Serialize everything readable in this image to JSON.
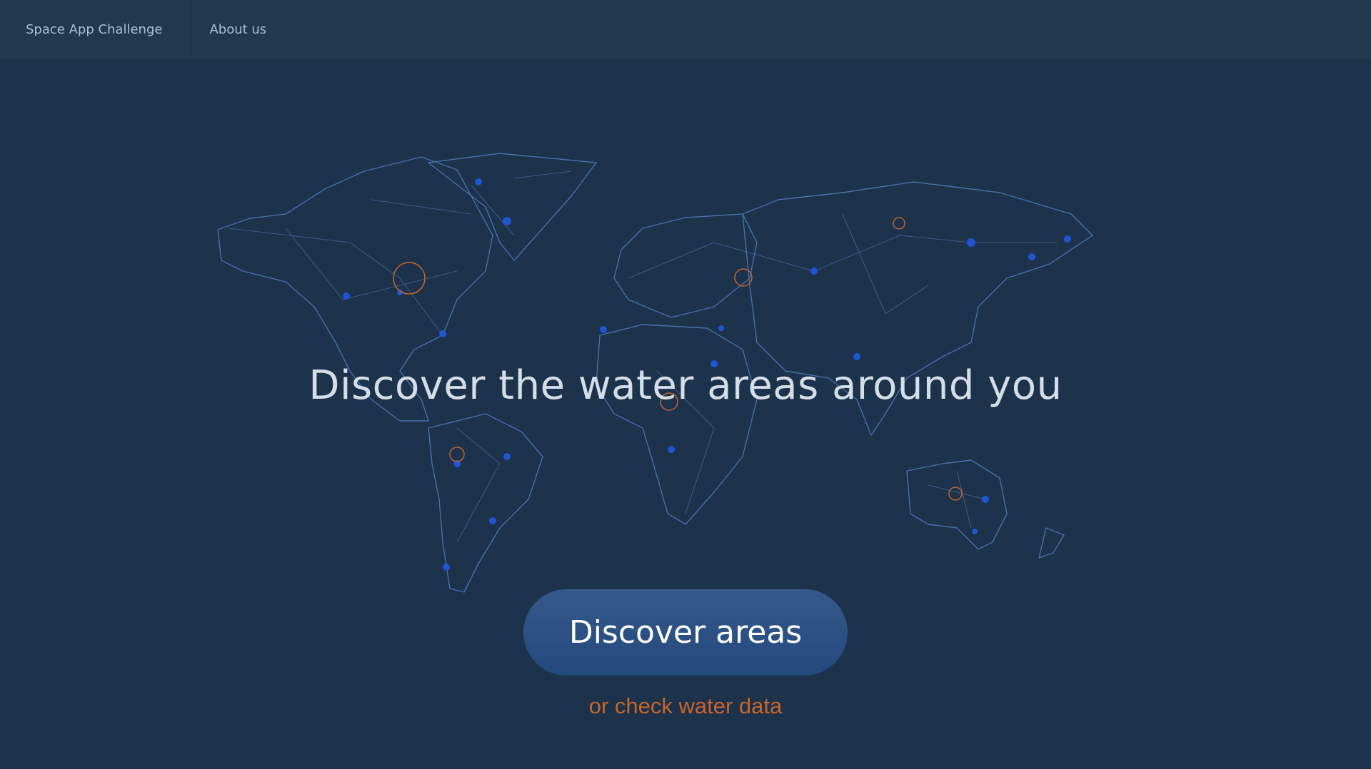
{
  "nav": {
    "brand_label": "Space App Challenge",
    "about_label": "About us"
  },
  "hero": {
    "headline": "Discover the water areas around you",
    "cta_label": "Discover areas",
    "secondary_link": "or check water data"
  },
  "colors": {
    "background": "#1d324b",
    "nav_background": "#22384f",
    "nav_text": "#a9bfd6",
    "map_line": "#5a82c1",
    "map_dot": "#1f56d6",
    "highlight_ring": "#c7652b",
    "cta_button": "#2c5286",
    "link": "#c7652b"
  },
  "icons": {
    "map": "world-network-map-icon"
  }
}
